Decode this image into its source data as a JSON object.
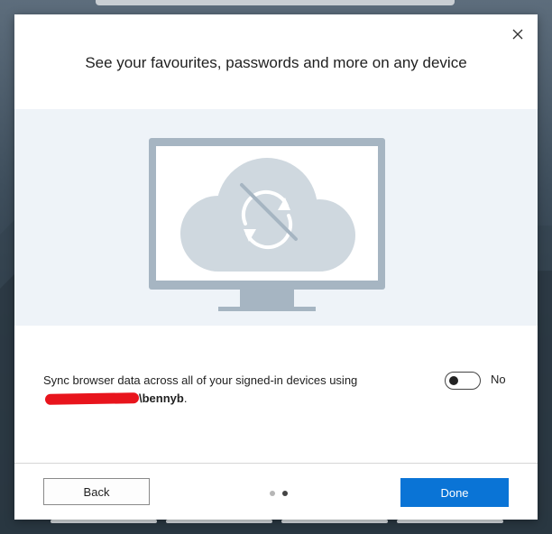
{
  "dialog": {
    "title": "See your favourites, passwords and more on any device",
    "close_icon": "close-icon",
    "illustration_icon": "sync-disabled-monitor-icon"
  },
  "sync": {
    "description_prefix": "Sync browser data across all of your signed-in devices using",
    "username": "\\bennyb",
    "suffix": ".",
    "toggle_state_label": "No",
    "toggle_on": false
  },
  "footer": {
    "back_label": "Back",
    "done_label": "Done",
    "page_count": 2,
    "current_page": 2
  },
  "colors": {
    "primary": "#0a74d6",
    "hero_bg": "#eef3f8",
    "monitor": "#a6b5c2",
    "cloud": "#cfd8df",
    "redaction": "#e8141c"
  }
}
